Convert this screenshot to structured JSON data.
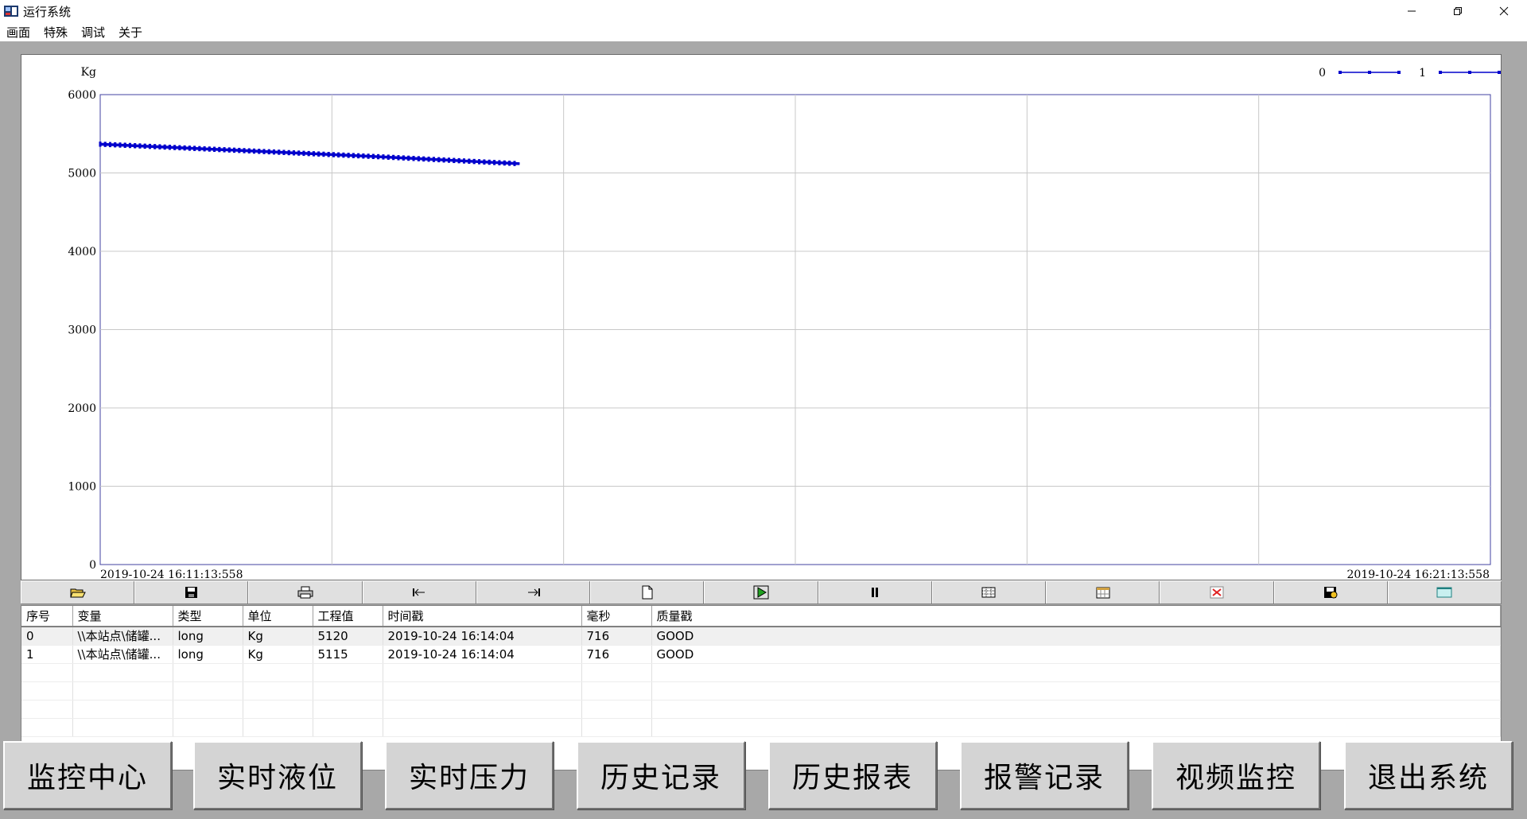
{
  "window": {
    "title": "运行系统"
  },
  "menu": [
    "画面",
    "特殊",
    "调试",
    "关于"
  ],
  "chart_data": {
    "type": "line",
    "ylabel": "Kg",
    "ylim": [
      0,
      6000
    ],
    "yticks": [
      "6000",
      "5000",
      "4000",
      "3000",
      "2000",
      "1000",
      "0"
    ],
    "x_start_label": "2019-10-24  16:11:13:558",
    "x_end_label": "2019-10-24  16:21:13:558",
    "x_range_minutes": [
      0,
      10
    ],
    "grid": true,
    "legend_position": "top-right",
    "series": [
      {
        "name": "0",
        "color": "#0000cc",
        "x_minutes": [
          0,
          1,
          2,
          3.0167
        ],
        "values": [
          5370,
          5290,
          5210,
          5120
        ]
      },
      {
        "name": "1",
        "color": "#0000cc",
        "x_minutes": [
          0,
          1,
          2,
          3.0167
        ],
        "values": [
          5365,
          5285,
          5205,
          5115
        ]
      }
    ]
  },
  "toolbar": [
    "open-icon",
    "save-icon",
    "print-icon",
    "go-start-icon",
    "go-end-icon",
    "new-page-icon",
    "play-icon",
    "pause-icon",
    "grid-icon",
    "calendar-icon",
    "delete-icon",
    "export-icon",
    "window-icon"
  ],
  "table": {
    "columns": [
      "序号",
      "变量",
      "类型",
      "单位",
      "工程值",
      "时间戳",
      "毫秒",
      "质量戳"
    ],
    "rows": [
      [
        "0",
        "\\\\本站点\\储罐...",
        "long",
        "Kg",
        "5120",
        "2019-10-24 16:14:04",
        "716",
        "GOOD"
      ],
      [
        "1",
        "\\\\本站点\\储罐...",
        "long",
        "Kg",
        "5115",
        "2019-10-24 16:14:04",
        "716",
        "GOOD"
      ]
    ]
  },
  "nav": [
    "监控中心",
    "实时液位",
    "实时压力",
    "历史记录",
    "历史报表",
    "报警记录",
    "视频监控",
    "退出系统"
  ]
}
